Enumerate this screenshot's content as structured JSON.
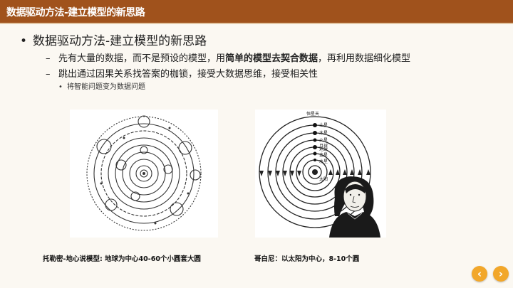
{
  "slide": {
    "title": "数据驱动方法-建立模型的新思路"
  },
  "content": {
    "bullet1": "数据驱动方法-建立模型的新思路",
    "sub1_prefix": "先有大量的数据，而不是预设的模型，用",
    "sub1_bold": "简单的模型去契合数据",
    "sub1_suffix": "，再利用数据细化模型",
    "sub2": "跳出通过因果关系找答案的枷锁，接受大数据思维，接受相关性",
    "sub3": "将智能问题变为数据问题"
  },
  "figures": {
    "ptolemy_caption": "托勒密-地心说模型: 地球为中心40-60个小圆套大圆",
    "copernicus_caption": "哥白尼：以太阳为中心，8-10个圆",
    "copernicus_labels": [
      "恒星天",
      "土星",
      "木星",
      "火星",
      "月球",
      "地球",
      "金星",
      "水星",
      "太阳"
    ]
  },
  "nav": {
    "prev": "‹",
    "next": "›"
  },
  "colors": {
    "title_bar": "#a0521c",
    "nav_button": "#f2a72a",
    "background": "#fbf8f2"
  }
}
